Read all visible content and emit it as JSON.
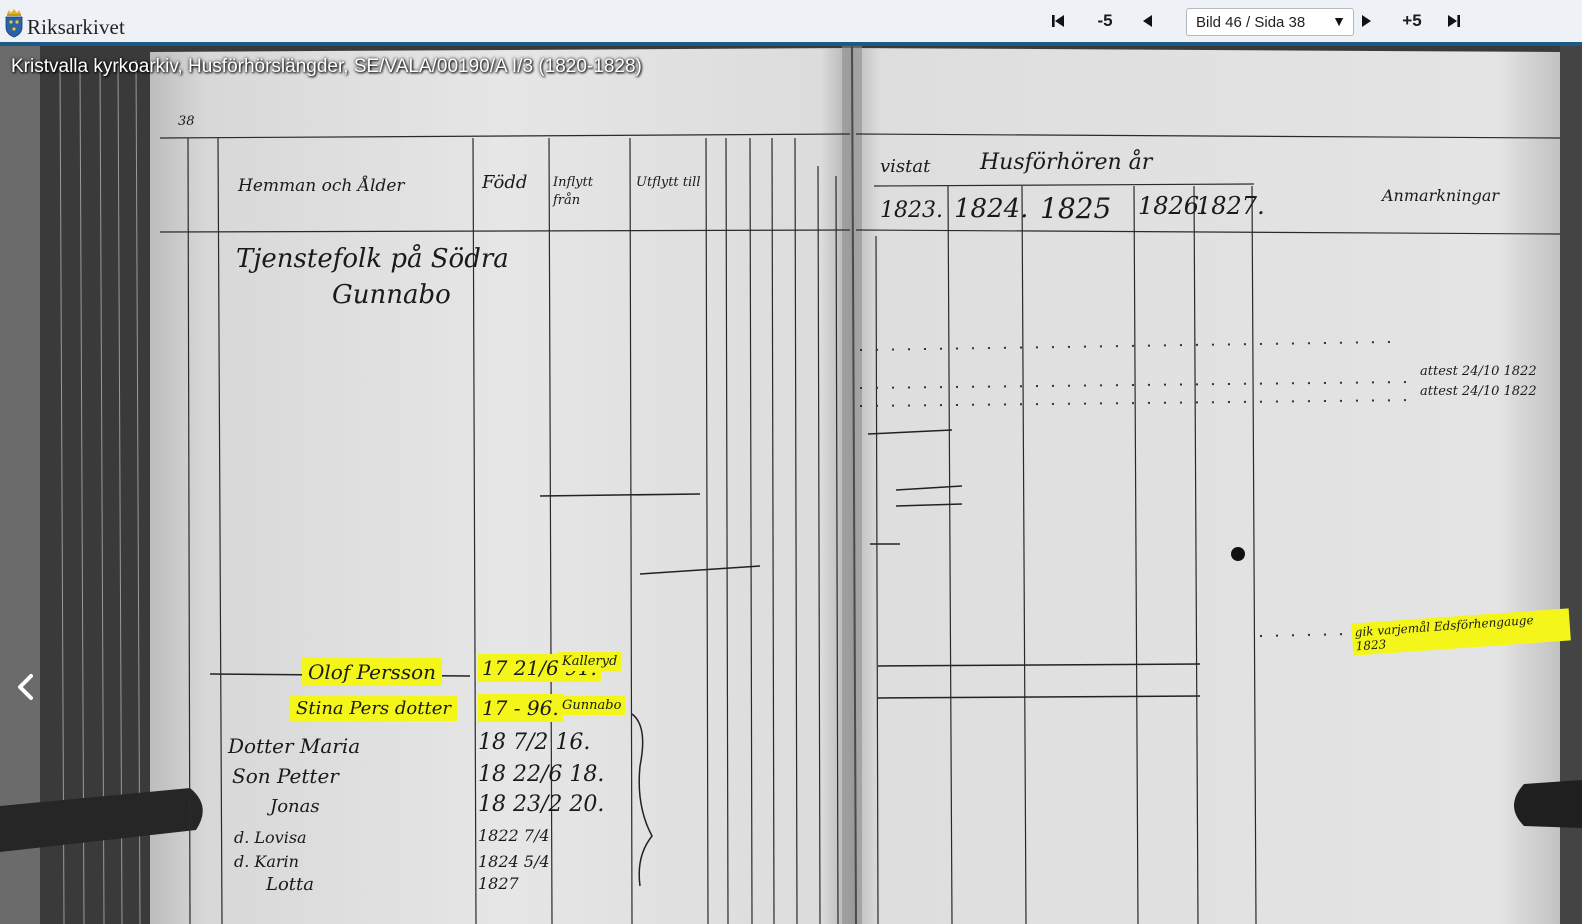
{
  "brand": {
    "name": "Riksarkivet"
  },
  "navigation": {
    "first_icon": "skip-to-first-icon",
    "back5_label": "-5",
    "prev_icon": "previous-icon",
    "page_select": {
      "value": "Bild 46 / Sida 38",
      "caret": "▼"
    },
    "next_icon": "next-icon",
    "fwd5_label": "+5",
    "last_icon": "skip-to-last-icon"
  },
  "document": {
    "title": "Kristvalla kyrkoarkiv, Husförhörslängder, SE/VALA/00190/A I/3 (1820-1828)",
    "prev_page_icon": "chevron-left-icon"
  },
  "ledger": {
    "page_number": "38",
    "headers": {
      "hemman": "Hemman och Ålder",
      "fodd": "Född",
      "inflytt": "Inflytt från",
      "utflytt": "Utflytt till",
      "vistat": "vistat",
      "husforhoren": "Husförhören år",
      "years": [
        "1823.",
        "1824.",
        "1825",
        "1826.",
        "1827."
      ],
      "anmarkningar": "Anmarkningar"
    },
    "section_title_1": "Tjenstefolk på Södra",
    "section_title_2": "Gunnabo",
    "rows": [
      {
        "name": "Olof Persson",
        "born": "17 21/6 91.",
        "from": "Kalleryd"
      },
      {
        "name": "Stina Pers dotter",
        "born": "17 - 96.",
        "from": "Gunnabo"
      },
      {
        "name": "Dotter Maria",
        "born": "18 7/2 16."
      },
      {
        "name": "Son Petter",
        "born": "18 22/6 18."
      },
      {
        "name": "Jonas",
        "born": "18 23/2 20."
      },
      {
        "name": "d. Lovisa",
        "born": "1822 7/4"
      },
      {
        "name": "d. Karin",
        "born": "1824 5/4"
      },
      {
        "name": "Lotta",
        "born": "1827"
      }
    ],
    "notes": {
      "attest1": "attest 24/10 1822",
      "attest2": "attest 24/10 1822",
      "margin_note": "gik varjemål Edsförhengauge 1823"
    }
  }
}
